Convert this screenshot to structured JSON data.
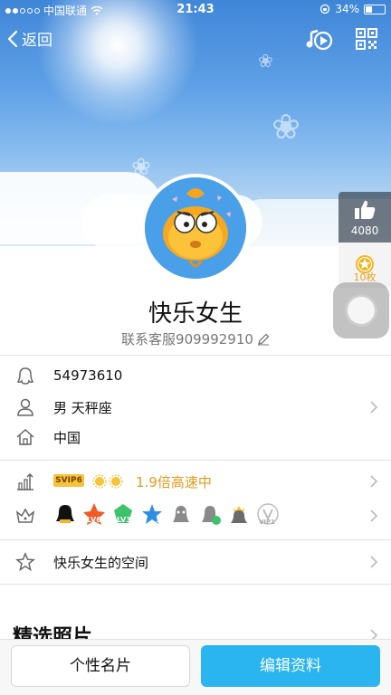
{
  "status_bar": {
    "carrier": "中国联通",
    "time": "21:43",
    "battery_percent_text": "34%",
    "battery_level": 0.34
  },
  "nav": {
    "back_label": "返回",
    "music_icon": "music-play-icon",
    "qr_icon": "qr-code-icon"
  },
  "side": {
    "like_count": "4080",
    "medal_count": "10枚"
  },
  "profile": {
    "nickname": "快乐女生",
    "service_line": "联系客服909992910"
  },
  "info": {
    "qq_number": "54973610",
    "gender_constellation": "男 天秤座",
    "location": "中国"
  },
  "vip": {
    "svip_tag": "SVIP6",
    "speed_text": "1.9倍高速中"
  },
  "badges": {
    "labels": [
      "",
      "LV6",
      "LV3",
      "3",
      "",
      "",
      "",
      "VIP1"
    ]
  },
  "space": {
    "label": "快乐女生的空间"
  },
  "photos": {
    "title": "精选照片"
  },
  "bottom": {
    "card_label": "个性名片",
    "edit_label": "编辑资料"
  },
  "colors": {
    "accent": "#2ab4f0",
    "speed": "#e29b20",
    "medal": "#e6a417"
  }
}
